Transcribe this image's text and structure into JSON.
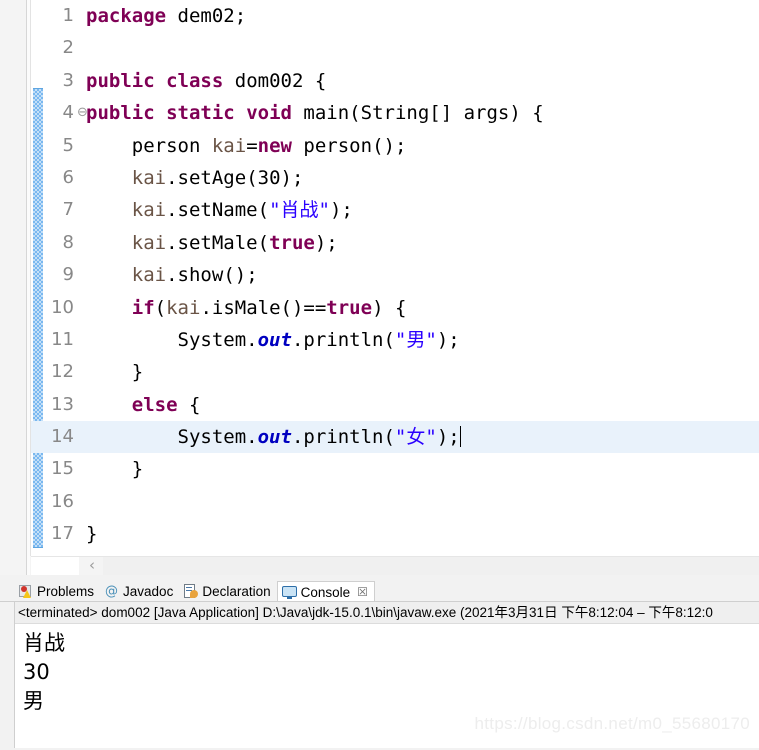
{
  "editor": {
    "name": "java-source-editor",
    "current_line": 14,
    "change_bar": {
      "from_line": 4,
      "to_line": 17,
      "color": "#7ab8ef"
    },
    "colors": {
      "keyword": "#7f0055",
      "string": "#2a00ff",
      "field_static": "#0000c0",
      "local_var": "#6a5446",
      "line_number": "#888888",
      "current_line_highlight": "#e9f2fb",
      "background": "#ffffff"
    },
    "lines": [
      {
        "num": "1",
        "fold": "",
        "text": "package dem02;"
      },
      {
        "num": "2",
        "fold": "",
        "text": ""
      },
      {
        "num": "3",
        "fold": "",
        "text": "public class dom002 {"
      },
      {
        "num": "4",
        "fold": "⊖",
        "text": "public static void main(String[] args) {"
      },
      {
        "num": "5",
        "fold": "",
        "text": "    person kai=new person();"
      },
      {
        "num": "6",
        "fold": "",
        "text": "    kai.setAge(30);"
      },
      {
        "num": "7",
        "fold": "",
        "text": "    kai.setName(\"肖战\");"
      },
      {
        "num": "8",
        "fold": "",
        "text": "    kai.setMale(true);"
      },
      {
        "num": "9",
        "fold": "",
        "text": "    kai.show();"
      },
      {
        "num": "10",
        "fold": "",
        "text": "    if(kai.isMale()==true) {"
      },
      {
        "num": "11",
        "fold": "",
        "text": "        System.out.println(\"男\");"
      },
      {
        "num": "12",
        "fold": "",
        "text": "    }"
      },
      {
        "num": "13",
        "fold": "",
        "text": "    else {"
      },
      {
        "num": "14",
        "fold": "",
        "text": "        System.out.println(\"女\");"
      },
      {
        "num": "15",
        "fold": "",
        "text": "    }"
      },
      {
        "num": "16",
        "fold": "",
        "text": ""
      },
      {
        "num": "17",
        "fold": "",
        "text": "}"
      }
    ],
    "hscroll": {
      "left_arrow": "‹"
    }
  },
  "view_panel": {
    "tabs": [
      {
        "id": "problems",
        "label": "Problems",
        "icon": "problems-icon",
        "active": false,
        "closable": false
      },
      {
        "id": "javadoc",
        "label": "Javadoc",
        "icon": "javadoc-icon",
        "active": false,
        "closable": false
      },
      {
        "id": "declaration",
        "label": "Declaration",
        "icon": "declaration-icon",
        "active": false,
        "closable": false
      },
      {
        "id": "console",
        "label": "Console",
        "icon": "console-icon",
        "active": true,
        "closable": true,
        "close_glyph": "☒"
      }
    ],
    "console": {
      "launch_line": "<terminated> dom002 [Java Application] D:\\Java\\jdk-15.0.1\\bin\\javaw.exe  (2021年3月31日 下午8:12:04 – 下午8:12:0",
      "output": [
        "肖战",
        "30",
        "男"
      ]
    }
  },
  "watermark": {
    "text": "https://blog.csdn.net/m0_55680170"
  }
}
